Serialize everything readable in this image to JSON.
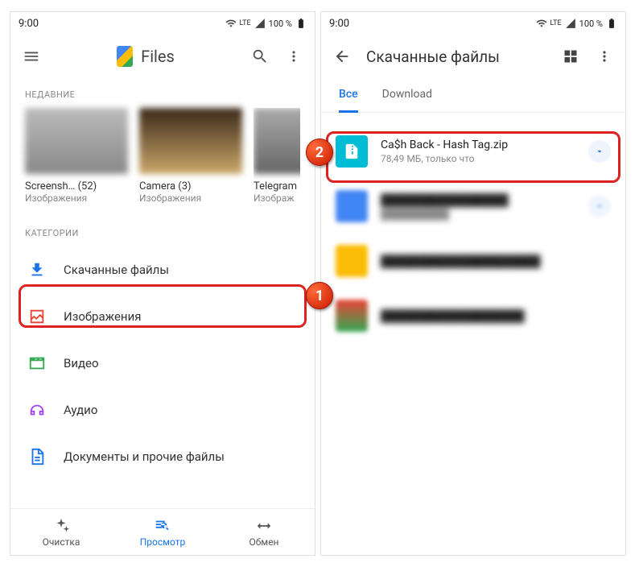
{
  "status": {
    "time": "9:00",
    "net": "LTE",
    "battery": "100 %"
  },
  "left": {
    "app_title": "Files",
    "section_recent": "НЕДАВНИЕ",
    "recent": [
      {
        "title": "Screensh… (52)",
        "sub": "Изображения"
      },
      {
        "title": "Camera (3)",
        "sub": "Изображения"
      },
      {
        "title": "Telegram",
        "sub": "Изображ"
      }
    ],
    "section_cat": "КАТЕГОРИИ",
    "cats": {
      "downloads": "Скачанные файлы",
      "images": "Изображения",
      "video": "Видео",
      "audio": "Аудио",
      "docs": "Документы и прочие файлы"
    },
    "nav": {
      "clean": "Очистка",
      "browse": "Просмотр",
      "share": "Обмен"
    }
  },
  "right": {
    "title": "Скачанные файлы",
    "tabs": {
      "all": "Все",
      "download": "Download"
    },
    "file": {
      "name": "Ca$h Back - Hash Tag.zip",
      "sub": "78,49 МБ, только что"
    },
    "blurred": [
      {
        "name": "████████████████",
        "sub": "██████████"
      },
      {
        "name": "████████████████████",
        "sub": ""
      },
      {
        "name": "██████████████████",
        "sub": ""
      }
    ]
  },
  "badges": {
    "one": "1",
    "two": "2"
  }
}
